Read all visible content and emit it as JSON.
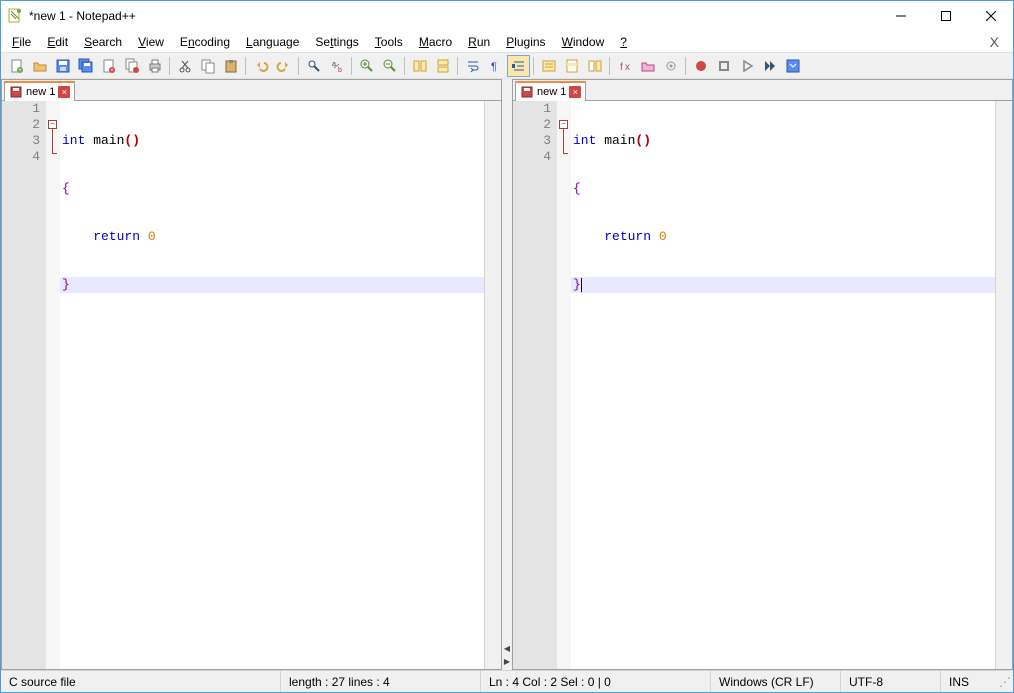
{
  "titlebar": {
    "title": "*new 1 - Notepad++"
  },
  "menu": {
    "items": [
      {
        "label": "File",
        "u": 0
      },
      {
        "label": "Edit",
        "u": 0
      },
      {
        "label": "Search",
        "u": 0
      },
      {
        "label": "View",
        "u": 0
      },
      {
        "label": "Encoding",
        "u": 1
      },
      {
        "label": "Language",
        "u": 0
      },
      {
        "label": "Settings",
        "u": 2
      },
      {
        "label": "Tools",
        "u": 0
      },
      {
        "label": "Macro",
        "u": 0
      },
      {
        "label": "Run",
        "u": 0
      },
      {
        "label": "Plugins",
        "u": 0
      },
      {
        "label": "Window",
        "u": 0
      },
      {
        "label": "?",
        "u": 0
      }
    ]
  },
  "toolbar": {
    "buttons": [
      {
        "name": "new-file-icon",
        "group": 0
      },
      {
        "name": "open-file-icon",
        "group": 0
      },
      {
        "name": "save-icon",
        "group": 0
      },
      {
        "name": "save-all-icon",
        "group": 0
      },
      {
        "name": "close-icon",
        "group": 0
      },
      {
        "name": "close-all-icon",
        "group": 0
      },
      {
        "name": "print-icon",
        "group": 0
      },
      {
        "name": "cut-icon",
        "group": 1
      },
      {
        "name": "copy-icon",
        "group": 1
      },
      {
        "name": "paste-icon",
        "group": 1
      },
      {
        "name": "undo-icon",
        "group": 2
      },
      {
        "name": "redo-icon",
        "group": 2
      },
      {
        "name": "find-icon",
        "group": 3
      },
      {
        "name": "replace-icon",
        "group": 3
      },
      {
        "name": "zoom-in-icon",
        "group": 4
      },
      {
        "name": "zoom-out-icon",
        "group": 4
      },
      {
        "name": "sync-v-icon",
        "group": 5
      },
      {
        "name": "sync-h-icon",
        "group": 5
      },
      {
        "name": "wordwrap-icon",
        "group": 6
      },
      {
        "name": "all-chars-icon",
        "group": 6
      },
      {
        "name": "indent-guide-icon",
        "group": 6,
        "active": true
      },
      {
        "name": "udl-icon",
        "group": 7
      },
      {
        "name": "doc-map-icon",
        "group": 7
      },
      {
        "name": "doc-list-icon",
        "group": 7
      },
      {
        "name": "func-list-icon",
        "group": 8
      },
      {
        "name": "folder-workspace-icon",
        "group": 8
      },
      {
        "name": "monitoring-icon",
        "group": 8
      },
      {
        "name": "record-macro-icon",
        "group": 9
      },
      {
        "name": "stop-macro-icon",
        "group": 9
      },
      {
        "name": "play-macro-icon",
        "group": 9
      },
      {
        "name": "play-multi-icon",
        "group": 9
      },
      {
        "name": "save-macro-icon",
        "group": 9
      }
    ]
  },
  "tabs": {
    "left": {
      "label": "new 1"
    },
    "right": {
      "label": "new 1"
    }
  },
  "code": {
    "lines": [
      "1",
      "2",
      "3",
      "4"
    ],
    "l1_kw": "int",
    "l1_name": " main",
    "l1_paren": "()",
    "l2_brace": "{",
    "l3_indent": "    ",
    "l3_kw": "return",
    "l3_sp": " ",
    "l3_num": "0",
    "l4_brace": "}"
  },
  "status": {
    "filetype": "C source file",
    "length": "length : 27    lines : 4",
    "pos": "Ln : 4    Col : 2    Sel : 0 | 0",
    "eol": "Windows (CR LF)",
    "enc": "UTF-8",
    "mode": "INS"
  }
}
